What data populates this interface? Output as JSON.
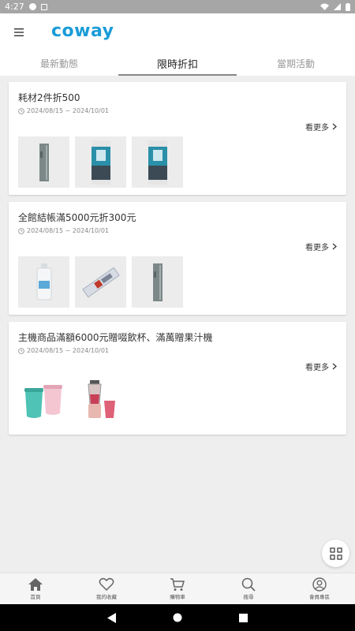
{
  "status_bar": {
    "time": "4:27"
  },
  "brand": {
    "logo_text": "coway",
    "accent": "#1a9cd8"
  },
  "tabs": [
    {
      "label": "最新動態",
      "active": false
    },
    {
      "label": "限時折扣",
      "active": true
    },
    {
      "label": "當期活動",
      "active": false
    }
  ],
  "promotions": [
    {
      "title": "耗材2件折500",
      "date": "2024/08/15 ~ 2024/10/01",
      "more_label": "看更多",
      "thumbnails": [
        "water-purifier-tower",
        "filter-box-teal",
        "filter-box-teal"
      ]
    },
    {
      "title": "全館結帳滿5000元折300元",
      "date": "2024/08/15 ~ 2024/10/01",
      "more_label": "看更多",
      "thumbnails": [
        "filter-cartridge",
        "filter-strip-pack",
        "water-purifier-tower"
      ]
    },
    {
      "title": "主機商品滿額6000元贈啜飲杯、滿萬贈果汁機",
      "date": "2024/08/15 ~ 2024/10/01",
      "more_label": "看更多",
      "thumbnails": [
        "tumbler-cups",
        "blender"
      ]
    }
  ],
  "bottom_nav": [
    {
      "label": "首頁",
      "icon": "home-icon"
    },
    {
      "label": "我的收藏",
      "icon": "heart-icon"
    },
    {
      "label": "購物車",
      "icon": "cart-icon"
    },
    {
      "label": "搜尋",
      "icon": "search-icon"
    },
    {
      "label": "會員專區",
      "icon": "user-icon"
    }
  ]
}
